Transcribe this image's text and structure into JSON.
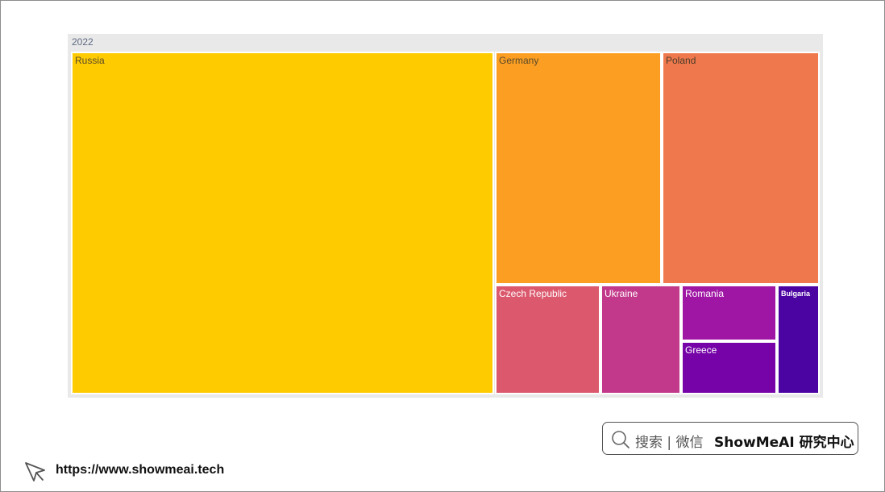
{
  "chart_data": {
    "type": "treemap",
    "root": "2022",
    "items": [
      {
        "name": "Russia",
        "color": "#fecb00",
        "label_color": "#5a4a2a"
      },
      {
        "name": "Germany",
        "color": "#fb9e22",
        "label_color": "#5a4a2a"
      },
      {
        "name": "Poland",
        "color": "#ef794c",
        "label_color": "#4a3a2a"
      },
      {
        "name": "Czech Republic",
        "color": "#db586d",
        "label_color": "#ffffff"
      },
      {
        "name": "Ukraine",
        "color": "#c2388a",
        "label_color": "#ffffff"
      },
      {
        "name": "Romania",
        "color": "#9f16a4",
        "label_color": "#ffffff"
      },
      {
        "name": "Greece",
        "color": "#7603a8",
        "label_color": "#ffffff"
      },
      {
        "name": "Bulgaria",
        "color": "#4b03a1",
        "label_color": "#ffffff"
      }
    ]
  },
  "footer": {
    "search_text": "搜索 | 微信",
    "brand_text": "ShowMeAI 研究中心",
    "url": "https://www.showmeai.tech"
  }
}
